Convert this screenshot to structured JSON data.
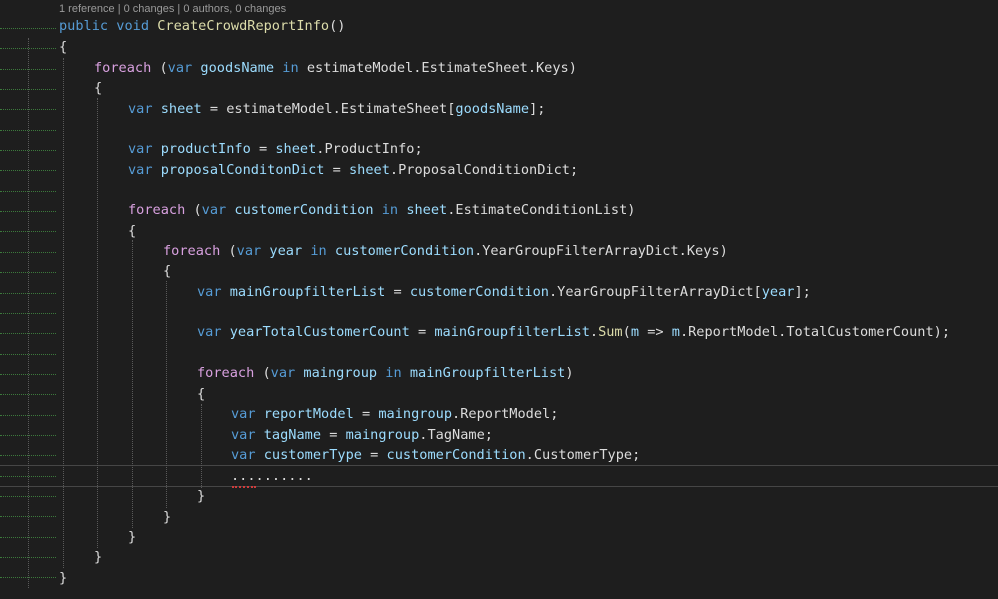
{
  "codelens": "1 reference | 0 changes | 0 authors, 0 changes",
  "code": {
    "l1": [
      "public",
      "void",
      "CreateCrowdReportInfo",
      "()"
    ],
    "l2": "{",
    "l3": [
      "foreach",
      "(",
      "var",
      "goodsName",
      "in",
      "estimateModel.EstimateSheet.Keys)"
    ],
    "l4": "{",
    "l5": [
      "var",
      "sheet",
      "= estimateModel.EstimateSheet[",
      "goodsName",
      "];"
    ],
    "l6": [
      "var",
      "productInfo",
      "=",
      "sheet",
      ".ProductInfo;"
    ],
    "l7": [
      "var",
      "proposalConditonDict",
      "=",
      "sheet",
      ".ProposalConditionDict;"
    ],
    "l8": [
      "foreach",
      "(",
      "var",
      "customerCondition",
      "in",
      "sheet",
      ".EstimateConditionList)"
    ],
    "l9": "{",
    "l10": [
      "foreach",
      "(",
      "var",
      "year",
      "in",
      "customerCondition",
      ".YearGroupFilterArrayDict.Keys)"
    ],
    "l11": "{",
    "l12": [
      "var",
      "mainGroupfilterList",
      "=",
      "customerCondition",
      ".YearGroupFilterArrayDict[",
      "year",
      "];"
    ],
    "l13": [
      "var",
      "yearTotalCustomerCount",
      "=",
      "mainGroupfilterList",
      ".",
      "Sum",
      "(",
      "m",
      "=>",
      "m",
      ".ReportModel.TotalCustomerCount);"
    ],
    "l14": [
      "foreach",
      "(",
      "var",
      "maingroup",
      "in",
      "mainGroupfilterList",
      ")"
    ],
    "l15": "{",
    "l16": [
      "var",
      "reportModel",
      "=",
      "maingroup",
      ".ReportModel;"
    ],
    "l17": [
      "var",
      "tagName",
      "=",
      "maingroup",
      ".TagName;"
    ],
    "l18": [
      "var",
      "customerType",
      "=",
      "customerCondition",
      ".CustomerType;"
    ],
    "l19": "..........",
    "l20": "}",
    "l21": "}",
    "l22": "}",
    "l23": "}",
    "l24": "}"
  }
}
